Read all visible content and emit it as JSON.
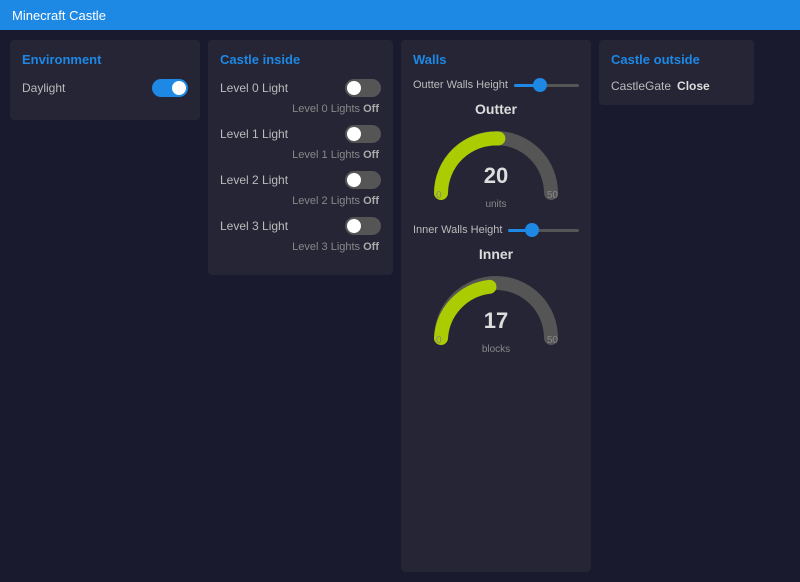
{
  "titlebar": {
    "title": "Minecraft Castle"
  },
  "environment": {
    "panel_title": "Environment",
    "daylight_label": "Daylight",
    "daylight_on": true
  },
  "castle_inside": {
    "panel_title": "Castle inside",
    "lights": [
      {
        "label": "Level 0 Light",
        "status_label": "Level 0 Lights",
        "status_value": "Off",
        "on": false
      },
      {
        "label": "Level 1 Light",
        "status_label": "Level 1 Lights",
        "status_value": "Off",
        "on": false
      },
      {
        "label": "Level 2 Light",
        "status_label": "Level 2 Lights",
        "status_value": "Off",
        "on": false
      },
      {
        "label": "Level 3 Light",
        "status_label": "Level 3 Lights",
        "status_value": "Off",
        "on": false
      }
    ]
  },
  "walls": {
    "panel_title": "Walls",
    "outter_walls_height_label": "Outter Walls Height",
    "outter_slider_value": 40,
    "outter_gauge_title": "Outter",
    "outter_gauge_value": 20,
    "outter_gauge_min": 0,
    "outter_gauge_max": 50,
    "outter_gauge_unit": "units",
    "inner_walls_height_label": "Inner Walls Height",
    "inner_slider_value": 34,
    "inner_gauge_title": "Inner",
    "inner_gauge_value": 17,
    "inner_gauge_min": 0,
    "inner_gauge_max": 50,
    "inner_gauge_unit": "blocks"
  },
  "castle_outside": {
    "panel_title": "Castle outside",
    "gate_label": "CastleGate",
    "gate_value": "Close"
  },
  "colors": {
    "accent": "#1e88e5",
    "gauge_fill": "#aacc00",
    "gauge_bg": "#555",
    "toggle_on": "#1e88e5",
    "toggle_off": "#555"
  }
}
